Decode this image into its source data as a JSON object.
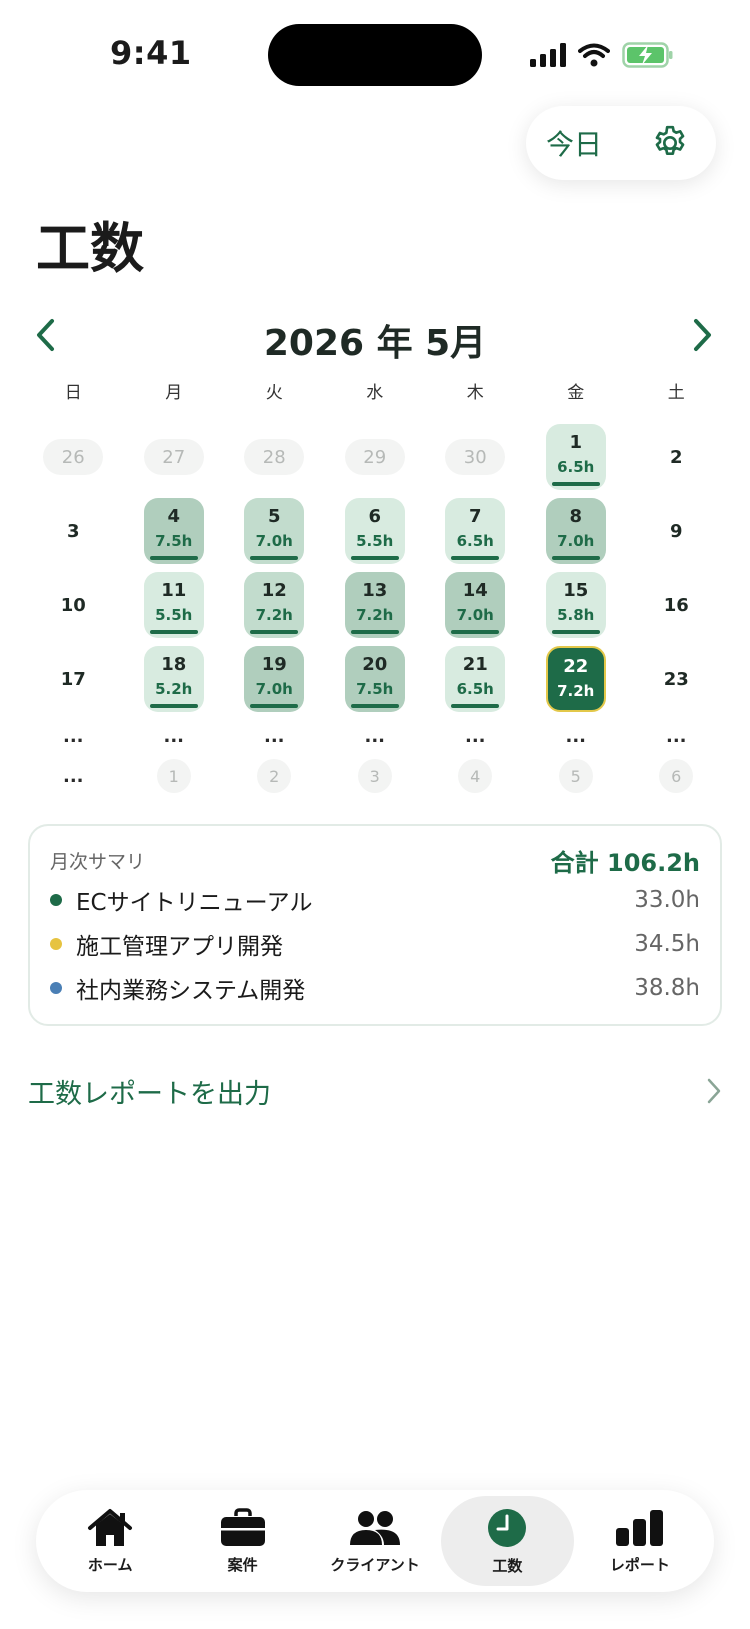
{
  "status_bar": {
    "time": "9:41"
  },
  "header": {
    "today_label": "今日",
    "title": "工数"
  },
  "calendar": {
    "month_label": "2026 年 5月",
    "weekdays": [
      "日",
      "月",
      "火",
      "水",
      "木",
      "金",
      "土"
    ],
    "prev_month_days": [
      "26",
      "27",
      "28",
      "29",
      "30"
    ],
    "days": {
      "1": {
        "num": "1",
        "hours": "6.5h"
      },
      "2": {
        "num": "2"
      },
      "3": {
        "num": "3"
      },
      "4": {
        "num": "4",
        "hours": "7.5h"
      },
      "5": {
        "num": "5",
        "hours": "7.0h"
      },
      "6": {
        "num": "6",
        "hours": "5.5h"
      },
      "7": {
        "num": "7",
        "hours": "6.5h"
      },
      "8": {
        "num": "8",
        "hours": "7.0h"
      },
      "9": {
        "num": "9"
      },
      "10": {
        "num": "10"
      },
      "11": {
        "num": "11",
        "hours": "5.5h"
      },
      "12": {
        "num": "12",
        "hours": "7.2h"
      },
      "13": {
        "num": "13",
        "hours": "7.2h"
      },
      "14": {
        "num": "14",
        "hours": "7.0h"
      },
      "15": {
        "num": "15",
        "hours": "5.8h"
      },
      "16": {
        "num": "16"
      },
      "17": {
        "num": "17"
      },
      "18": {
        "num": "18",
        "hours": "5.2h"
      },
      "19": {
        "num": "19",
        "hours": "7.0h"
      },
      "20": {
        "num": "20",
        "hours": "7.5h"
      },
      "21": {
        "num": "21",
        "hours": "6.5h"
      },
      "22": {
        "num": "22",
        "hours": "7.2h"
      },
      "23": {
        "num": "23"
      }
    },
    "ellipsis": "...",
    "next_month_days": [
      "1",
      "2",
      "3",
      "4",
      "5",
      "6"
    ]
  },
  "summary": {
    "label": "月次サマリ",
    "total": "合計 106.2h",
    "items": [
      {
        "name": "ECサイトリニューアル",
        "hours": "33.0h",
        "color": "#1e6b48"
      },
      {
        "name": "施工管理アプリ開発",
        "hours": "34.5h",
        "color": "#e6c340"
      },
      {
        "name": "社内業務システム開発",
        "hours": "38.8h",
        "color": "#4a7fb5"
      }
    ]
  },
  "export": {
    "label": "工数レポートを出力"
  },
  "tabs": [
    {
      "label": "ホーム",
      "icon": "house-icon"
    },
    {
      "label": "案件",
      "icon": "briefcase-icon"
    },
    {
      "label": "クライアント",
      "icon": "people-icon"
    },
    {
      "label": "工数",
      "icon": "clock-icon"
    },
    {
      "label": "レポート",
      "icon": "bar-chart-icon"
    }
  ],
  "colors": {
    "accent": "#1e6b48",
    "today_border": "#e3c84a"
  }
}
